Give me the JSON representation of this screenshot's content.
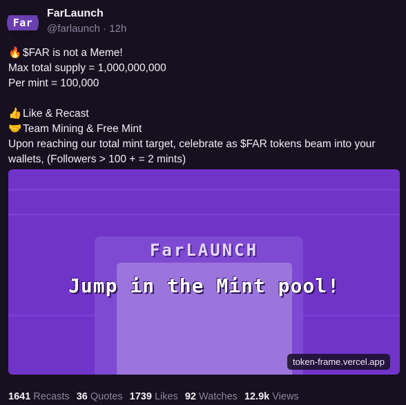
{
  "author": {
    "avatar_text": "Far",
    "name": "FarLaunch",
    "handle": "@farlaunch",
    "separator": "·",
    "time": "12h"
  },
  "post": {
    "line1_emoji": "🔥",
    "line1": "$FAR is not a Meme!",
    "line2": "Max total supply = 1,000,000,000",
    "line3": "Per mint = 100,000",
    "line4_emoji": "👍",
    "line4": "Like & Recast",
    "line5_emoji": "🤝",
    "line5": "Team Mining & Free Mint",
    "line6": "Upon reaching our total mint target, celebrate as $FAR tokens beam into your wallets, (Followers > 100 + = 2 mints)"
  },
  "frame": {
    "brand": "FarLAUNCH",
    "headline": "Jump in the Mint pool!",
    "url": "token-frame.vercel.app"
  },
  "stats": [
    {
      "count": "1641",
      "label": "Recasts"
    },
    {
      "count": "36",
      "label": "Quotes"
    },
    {
      "count": "1739",
      "label": "Likes"
    },
    {
      "count": "92",
      "label": "Watches"
    },
    {
      "count": "12.9k",
      "label": "Views"
    }
  ]
}
